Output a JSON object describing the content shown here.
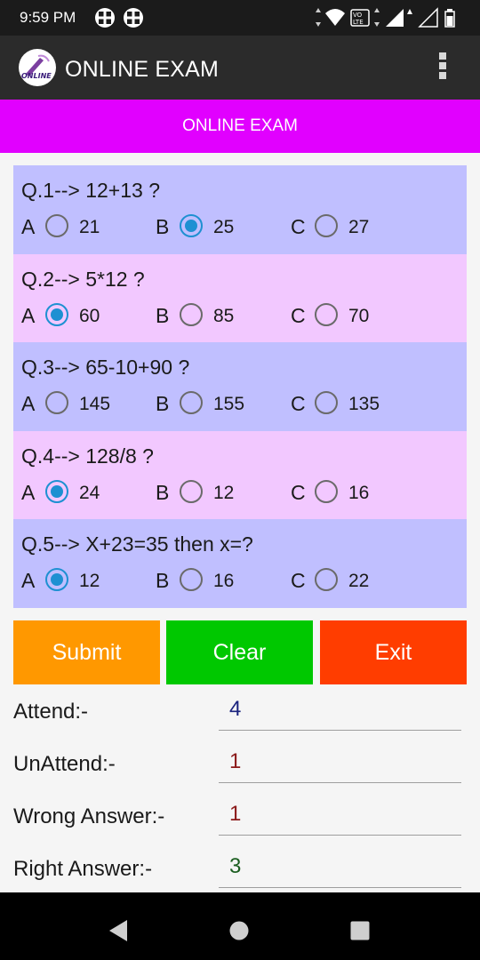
{
  "status_bar": {
    "time": "9:59 PM"
  },
  "app_bar": {
    "title": "ONLINE EXAM",
    "logo_text": "ONLINE"
  },
  "banner": {
    "title": "ONLINE EXAM"
  },
  "questions": [
    {
      "text": "Q.1--> 12+13 ?",
      "options": [
        {
          "letter": "A",
          "value": "21"
        },
        {
          "letter": "B",
          "value": "25"
        },
        {
          "letter": "C",
          "value": "27"
        }
      ],
      "selected": "B"
    },
    {
      "text": "Q.2--> 5*12 ?",
      "options": [
        {
          "letter": "A",
          "value": "60"
        },
        {
          "letter": "B",
          "value": "85"
        },
        {
          "letter": "C",
          "value": "70"
        }
      ],
      "selected": "A"
    },
    {
      "text": "Q.3--> 65-10+90 ?",
      "options": [
        {
          "letter": "A",
          "value": "145"
        },
        {
          "letter": "B",
          "value": "155"
        },
        {
          "letter": "C",
          "value": "135"
        }
      ],
      "selected": null
    },
    {
      "text": "Q.4--> 128/8 ?",
      "options": [
        {
          "letter": "A",
          "value": "24"
        },
        {
          "letter": "B",
          "value": "12"
        },
        {
          "letter": "C",
          "value": "16"
        }
      ],
      "selected": "A"
    },
    {
      "text": "Q.5--> X+23=35 then x=?",
      "options": [
        {
          "letter": "A",
          "value": "12"
        },
        {
          "letter": "B",
          "value": "16"
        },
        {
          "letter": "C",
          "value": "22"
        }
      ],
      "selected": "A"
    }
  ],
  "buttons": {
    "submit": "Submit",
    "clear": "Clear",
    "exit": "Exit"
  },
  "stats": [
    {
      "label": "Attend:-",
      "value": "4",
      "color": "#1a237e"
    },
    {
      "label": "UnAttend:-",
      "value": "1",
      "color": "#8b1a1a"
    },
    {
      "label": "Wrong Answer:-",
      "value": "1",
      "color": "#8b1a1a"
    },
    {
      "label": "Right Answer:-",
      "value": "3",
      "color": "#1b5e20"
    }
  ],
  "colors": {
    "banner": "#e100ff",
    "question_blue": "#c0bfff",
    "question_pink": "#f2c8ff",
    "radio_checked": "#1e90d2",
    "submit": "#ff9800",
    "clear": "#00c800",
    "exit": "#ff3d00"
  }
}
